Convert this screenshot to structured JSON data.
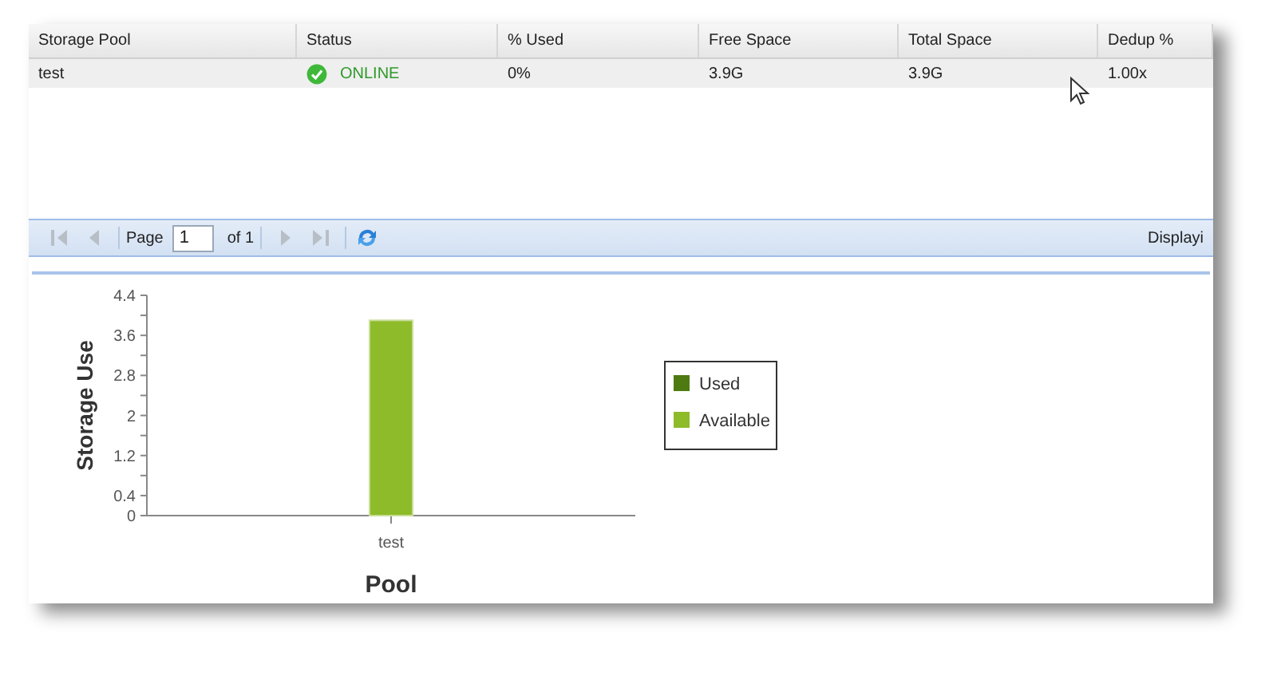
{
  "table": {
    "columns": [
      "Storage Pool",
      "Status",
      "% Used",
      "Free Space",
      "Total Space",
      "Dedup %"
    ],
    "rows": [
      {
        "pool": "test",
        "status": "ONLINE",
        "status_ok": true,
        "used": "0%",
        "free": "3.9G",
        "total": "3.9G",
        "dedup": "1.00x",
        "selected": false
      }
    ]
  },
  "pager": {
    "first_disabled": true,
    "prev_disabled": true,
    "page_label": "Page",
    "page": "1",
    "of": "of 1",
    "next_disabled": true,
    "last_disabled": true,
    "display_text": "Displayi"
  },
  "chart": {
    "chart_data": {
      "type": "bar",
      "stacked": true,
      "xlabel": "Pool",
      "ylabel": "Storage Use",
      "categories": [
        "test"
      ],
      "series": [
        {
          "name": "Used",
          "color": "#4e7a12",
          "values": [
            0
          ]
        },
        {
          "name": "Available",
          "color": "#8dbb2a",
          "values": [
            3.9
          ]
        }
      ],
      "ylim": [
        0,
        4.4
      ],
      "yticks": [
        0,
        0.4,
        1.2,
        2,
        2.8,
        3.6,
        4.4
      ]
    }
  }
}
